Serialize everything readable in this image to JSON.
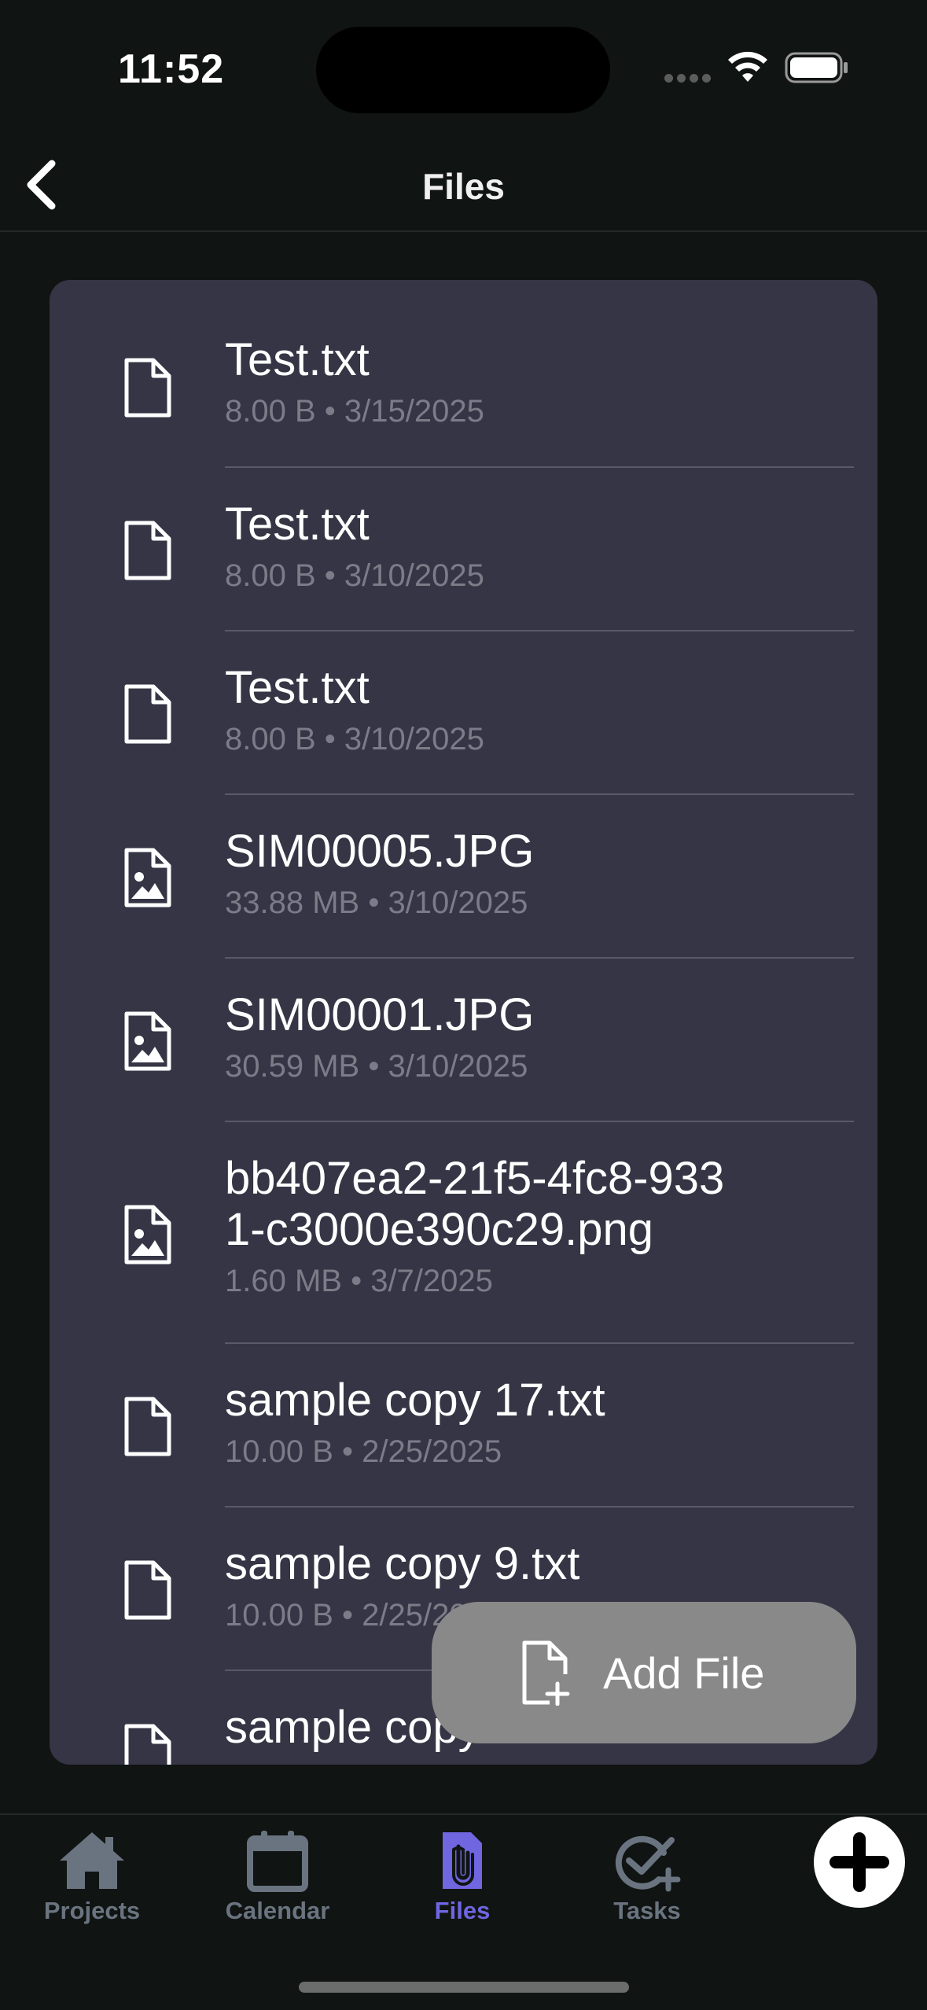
{
  "status_bar": {
    "time": "11:52"
  },
  "nav": {
    "title": "Files"
  },
  "files": [
    {
      "name": "Test.txt",
      "meta": "8.00 B • 3/15/2025",
      "kind": "document-icon"
    },
    {
      "name": "Test.txt",
      "meta": "8.00 B • 3/10/2025",
      "kind": "document-icon"
    },
    {
      "name": "Test.txt",
      "meta": "8.00 B • 3/10/2025",
      "kind": "document-icon"
    },
    {
      "name": "SIM00005.JPG",
      "meta": "33.88 MB • 3/10/2025",
      "kind": "image-file-icon"
    },
    {
      "name": "SIM00001.JPG",
      "meta": "30.59 MB • 3/10/2025",
      "kind": "image-file-icon"
    },
    {
      "name": "bb407ea2-21f5-4fc8-933\n1-c3000e390c29.png",
      "meta": "1.60 MB • 3/7/2025",
      "kind": "image-file-icon"
    },
    {
      "name": "sample copy 17.txt",
      "meta": "10.00 B • 2/25/2025",
      "kind": "document-icon"
    },
    {
      "name": "sample copy 9.txt",
      "meta": "10.00 B • 2/25/2025",
      "kind": "document-icon"
    },
    {
      "name": "sample copy",
      "meta": "",
      "kind": "document-icon"
    }
  ],
  "add_file": {
    "label": "Add File"
  },
  "tabs": [
    {
      "label": "Projects",
      "icon": "home-icon",
      "active": false
    },
    {
      "label": "Calendar",
      "icon": "calendar-icon",
      "active": false
    },
    {
      "label": "Files",
      "icon": "paperclip-file-icon",
      "active": true
    },
    {
      "label": "Tasks",
      "icon": "check-circle-plus-icon",
      "active": false
    }
  ],
  "colors": {
    "background": "#101412",
    "card": "#363545",
    "accent": "#6f66e0",
    "tab_inactive": "#6a7480",
    "meta_text": "#7c7b88",
    "add_button": "#898989"
  }
}
